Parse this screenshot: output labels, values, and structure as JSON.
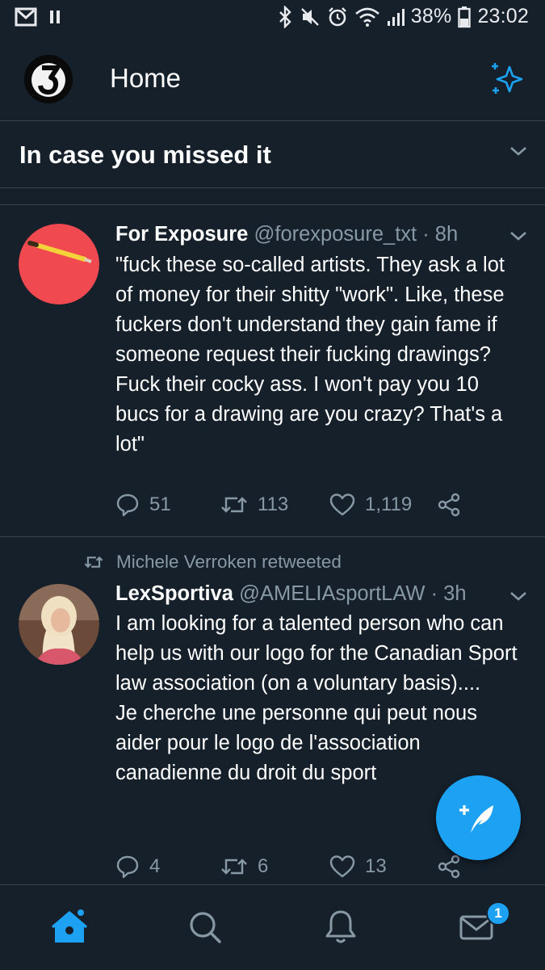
{
  "status_bar": {
    "battery": "38%",
    "time": "23:02"
  },
  "header": {
    "title": "Home"
  },
  "icymi": {
    "title": "In case you missed it"
  },
  "tweets": [
    {
      "name": "For Exposure",
      "handle": "@forexposure_txt",
      "time": "· 8h",
      "text": "\"fuck these so-called artists. They ask a lot of money for their shitty \"work\". Like, these fuckers don't understand they gain fame if someone request their fucking drawings? Fuck their cocky ass. I won't pay you 10 bucs for a drawing are you crazy? That's a lot\"",
      "replies": "51",
      "retweets": "113",
      "likes": "1,119"
    },
    {
      "retweeted_by": "Michele Verroken retweeted",
      "name": "LexSportiva",
      "handle": "@AMELIAsportLAW",
      "time": "· 3h",
      "text": "I am looking for a talented person who can help us with our logo for the Canadian Sport law association (on a voluntary basis)....\nJe cherche une personne qui peut nous aider pour le logo de l'association canadienne du droit du sport",
      "replies": "4",
      "retweets": "6",
      "likes": "13"
    }
  ],
  "nav": {
    "messages_badge": "1"
  },
  "colors": {
    "background": "#15202b",
    "accent": "#1da1f2",
    "secondary_text": "#8899a6",
    "divider": "#38444d"
  },
  "icons": [
    "gmail-icon",
    "pause-icon",
    "bluetooth-icon",
    "mute-icon",
    "alarm-icon",
    "wifi-icon",
    "signal-icon",
    "battery-icon",
    "sparkle-icon",
    "chevron-down-icon",
    "reply-icon",
    "retweet-icon",
    "like-icon",
    "share-icon",
    "compose-icon",
    "home-icon",
    "search-icon",
    "notifications-icon",
    "messages-icon"
  ]
}
